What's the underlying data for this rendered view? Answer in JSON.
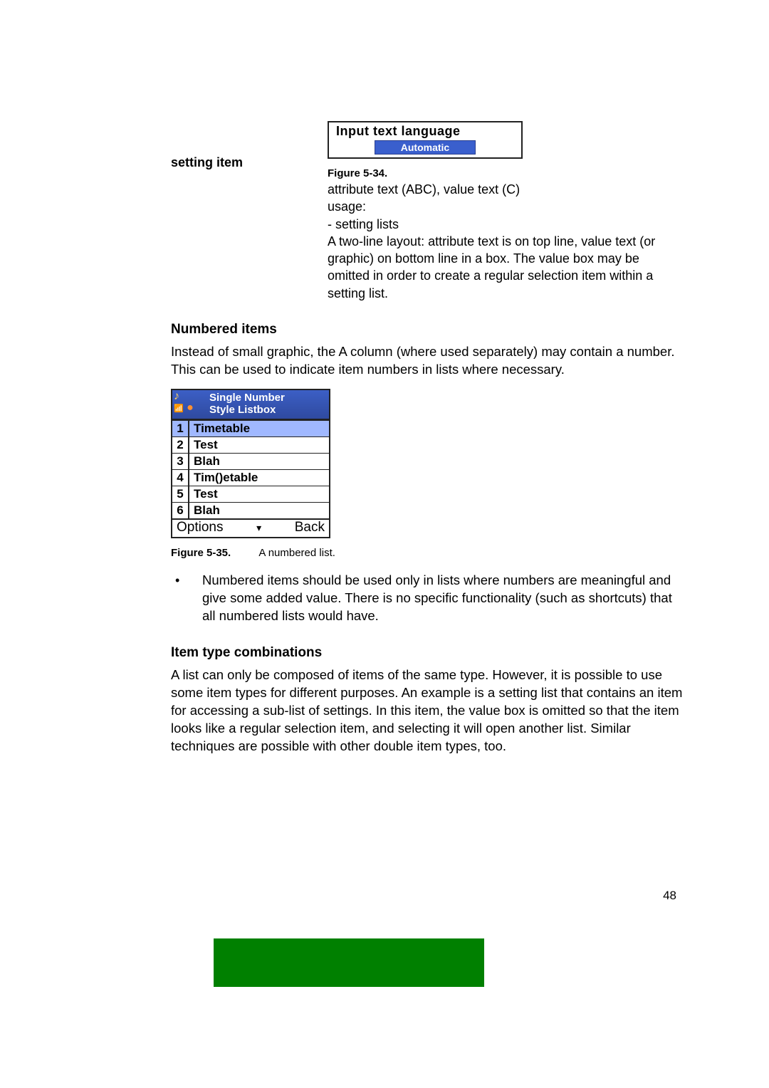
{
  "row1": {
    "left_label": "setting item",
    "fig34": {
      "attr_text": "Input text language",
      "value_text": "Automatic",
      "fig_label": "Figure 5-34.",
      "desc_line1": "attribute text (ABC), value text (C)",
      "desc_line2": "usage:",
      "desc_line3": "- setting lists",
      "desc_para": "A two-line layout: attribute text is on top line, value text (or graphic) on bottom line in a box. The value box may be omitted in order to create a regular selection item within a setting list."
    }
  },
  "numbered": {
    "heading": "Numbered items",
    "para": "Instead of small graphic, the A column (where used separately) may contain a number. This can be used to indicate item numbers in lists where necessary."
  },
  "phone": {
    "title_line1": "Single Number",
    "title_line2": "Style Listbox",
    "icon_music": "♪",
    "icon_signal": "📶",
    "icon_ball": "●",
    "rows": [
      {
        "n": "1",
        "t": "Timetable",
        "selected": true
      },
      {
        "n": "2",
        "t": "Test"
      },
      {
        "n": "3",
        "t": "Blah"
      },
      {
        "n": "4",
        "t": "Tim()etable"
      },
      {
        "n": "5",
        "t": "Test"
      },
      {
        "n": "6",
        "t": "Blah"
      }
    ],
    "soft_left": "Options",
    "soft_mid": "▾",
    "soft_right": "Back"
  },
  "fig35": {
    "label": "Figure 5-35.",
    "caption": "A numbered list."
  },
  "bullet": "Numbered items should be used only in lists where numbers are meaningful and give some added value. There is no specific functionality (such as shortcuts) that all numbered lists would have.",
  "combo": {
    "heading": "Item type combinations",
    "para": "A list can only be composed of items of the same type. However, it is possible to use some item types for different purposes. An example is a setting list that contains an item for accessing a sub-list of settings. In this item, the value box is omitted so that the item looks like a regular selection item, and selecting it will open another list. Similar techniques are possible with other double item types, too."
  },
  "page_number": "48"
}
